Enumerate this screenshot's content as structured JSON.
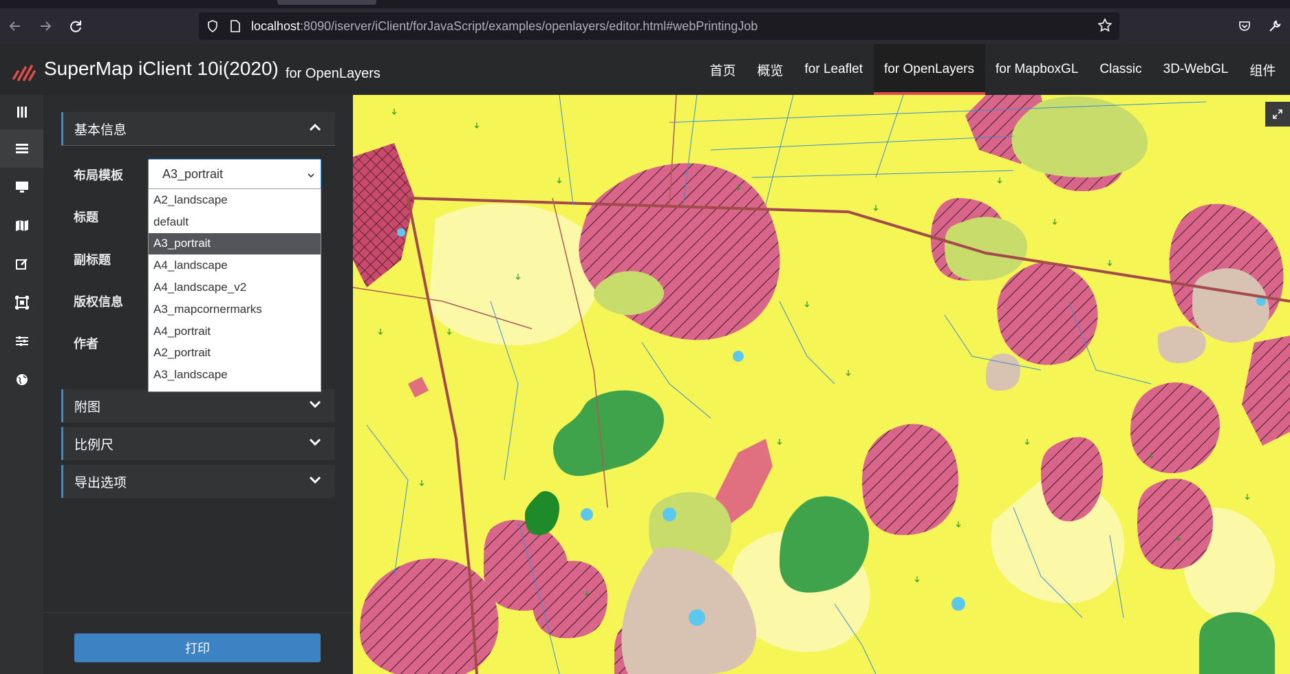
{
  "browser": {
    "url_host": "localhost",
    "url_rest": ":8090/iserver/iClient/forJavaScript/examples/openlayers/editor.html#webPrintingJob"
  },
  "header": {
    "title": "SuperMap iClient 10i(2020)",
    "subtitle": "for OpenLayers",
    "nav": [
      "首页",
      "概览",
      "for Leaflet",
      "for OpenLayers",
      "for MapboxGL",
      "Classic",
      "3D-WebGL",
      "组件"
    ],
    "active_nav": "for OpenLayers",
    "accent_color": "#e14d4d"
  },
  "iconbar": [
    "menu-icon",
    "list-icon",
    "monitor-icon",
    "map-icon",
    "edit-icon",
    "frame-icon",
    "sliders-icon",
    "globe-icon"
  ],
  "panel": {
    "basic_section": "基本信息",
    "fields": {
      "layout_template": "布局模板",
      "title": "标题",
      "subtitle": "副标题",
      "copyright": "版权信息",
      "author": "作者"
    },
    "layout_value": "A3_portrait",
    "options": [
      "A2_landscape",
      "default",
      "A3_portrait",
      "A4_landscape",
      "A4_landscape_v2",
      "A3_mapcornermarks",
      "A4_portrait",
      "A2_portrait",
      "A3_landscape"
    ],
    "sections": [
      "附图",
      "比例尺",
      "导出选项"
    ],
    "print_label": "打印"
  },
  "colors": {
    "map_base": "#f5f556",
    "land_pink": "#d9668a",
    "water": "#5cc8f0",
    "forest": "#3ea34a",
    "bare": "#d8c2b2"
  }
}
